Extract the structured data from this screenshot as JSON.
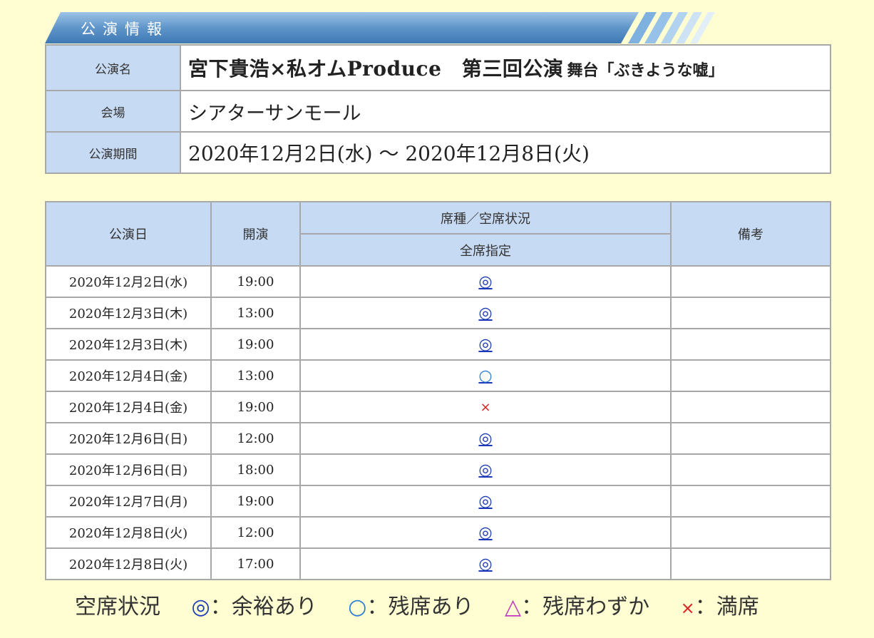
{
  "section": {
    "title": "公演情報"
  },
  "info": {
    "name_label": "公演名",
    "name_main": "宮下貴浩×私オムProduce　第三回公演",
    "name_sub": "舞台「ぶきような嘘」",
    "venue_label": "会場",
    "venue": "シアターサンモール",
    "period_label": "公演期間",
    "period": "2020年12月2日(水) 〜 2020年12月8日(火)"
  },
  "schedule": {
    "headers": {
      "date": "公演日",
      "time": "開演",
      "seat_group": "席種／空席状況",
      "seat_type": "全席指定",
      "remarks": "備考"
    },
    "rows": [
      {
        "date": "2020年12月2日(水)",
        "time": "19:00",
        "status": "◎",
        "remarks": ""
      },
      {
        "date": "2020年12月3日(木)",
        "time": "13:00",
        "status": "◎",
        "remarks": ""
      },
      {
        "date": "2020年12月3日(木)",
        "time": "19:00",
        "status": "◎",
        "remarks": ""
      },
      {
        "date": "2020年12月4日(金)",
        "time": "13:00",
        "status": "○",
        "remarks": ""
      },
      {
        "date": "2020年12月4日(金)",
        "time": "19:00",
        "status": "×",
        "remarks": ""
      },
      {
        "date": "2020年12月6日(日)",
        "time": "12:00",
        "status": "◎",
        "remarks": ""
      },
      {
        "date": "2020年12月6日(日)",
        "time": "18:00",
        "status": "◎",
        "remarks": ""
      },
      {
        "date": "2020年12月7日(月)",
        "time": "19:00",
        "status": "◎",
        "remarks": ""
      },
      {
        "date": "2020年12月8日(火)",
        "time": "12:00",
        "status": "◎",
        "remarks": ""
      },
      {
        "date": "2020年12月8日(火)",
        "time": "17:00",
        "status": "◎",
        "remarks": ""
      }
    ]
  },
  "legend": {
    "label": "空席状況",
    "items": [
      {
        "symbol": "◎",
        "text": "：余裕あり"
      },
      {
        "symbol": "○",
        "text": "：残席あり"
      },
      {
        "symbol": "△",
        "text": "：残席わずか"
      },
      {
        "symbol": "×",
        "text": "：満席"
      }
    ]
  },
  "colors": {
    "background": "#fefed2",
    "header_cell": "#c7daf3",
    "link": "#1a39b8",
    "sold_out": "#dd2222",
    "few_left": "#c238c2"
  }
}
